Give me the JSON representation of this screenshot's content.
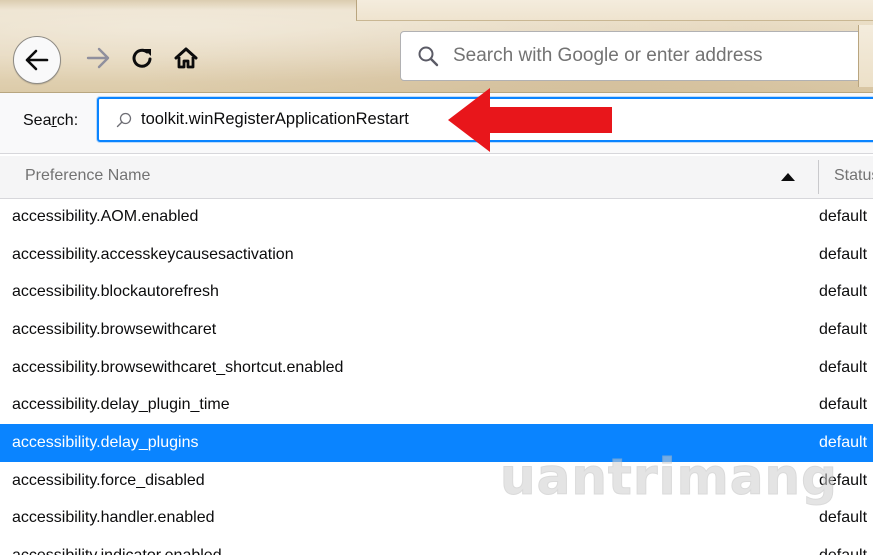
{
  "toolbar": {
    "url_placeholder": "Search with Google or enter address"
  },
  "search": {
    "label_prefix": "Sea",
    "label_underlined": "r",
    "label_suffix": "ch:",
    "value": "toolkit.winRegisterApplicationRestart"
  },
  "table": {
    "columns": [
      "Preference Name",
      "Status"
    ],
    "sort_column": "Preference Name",
    "sort_direction": "ascending",
    "rows": [
      {
        "name": "accessibility.AOM.enabled",
        "status": "default"
      },
      {
        "name": "accessibility.accesskeycausesactivation",
        "status": "default"
      },
      {
        "name": "accessibility.blockautorefresh",
        "status": "default"
      },
      {
        "name": "accessibility.browsewithcaret",
        "status": "default"
      },
      {
        "name": "accessibility.browsewithcaret_shortcut.enabled",
        "status": "default"
      },
      {
        "name": "accessibility.delay_plugin_time",
        "status": "default"
      },
      {
        "name": "accessibility.delay_plugins",
        "status": "default",
        "selected": true
      },
      {
        "name": "accessibility.force_disabled",
        "status": "default"
      },
      {
        "name": "accessibility.handler.enabled",
        "status": "default"
      },
      {
        "name": "accessibility.indicator.enabled",
        "status": "default"
      }
    ]
  },
  "watermark": {
    "text": "uantrimang"
  },
  "colors": {
    "accent": "#0a84ff",
    "arrow": "#e8161b",
    "selected_text": "#ffffff"
  },
  "icons": {
    "back": "back-arrow-icon",
    "forward": "forward-arrow-icon",
    "reload": "reload-icon",
    "home": "home-icon",
    "search": "search-icon",
    "sort": "sort-ascending-icon",
    "annotation": "red-arrow-icon"
  }
}
